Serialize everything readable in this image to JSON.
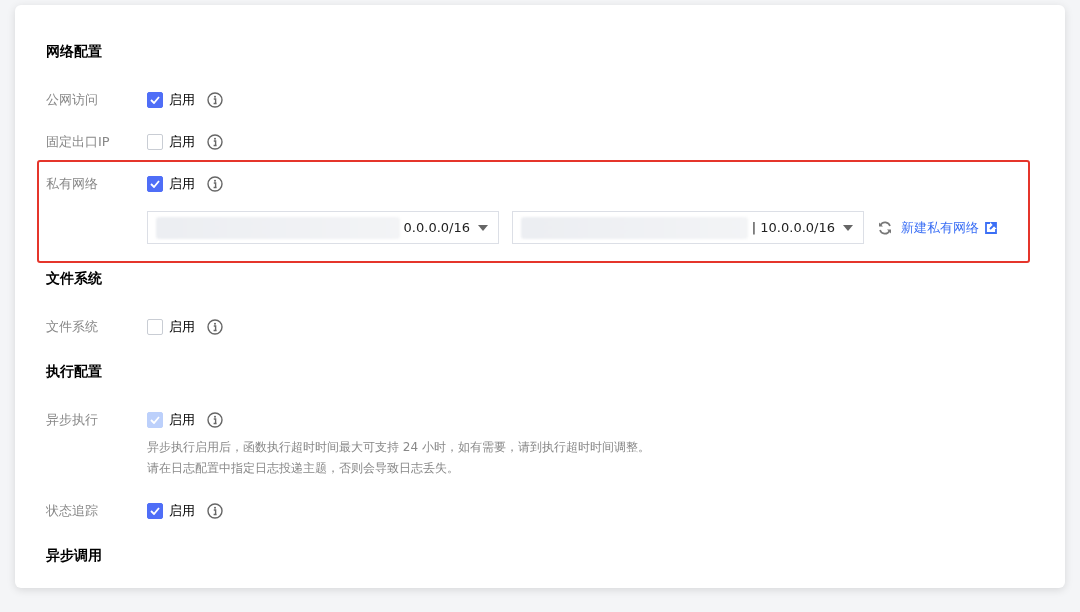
{
  "sections": [
    {
      "title": "网络配置",
      "rows": [
        {
          "label": "公网访问",
          "checkbox": {
            "label": "启用",
            "checked": true,
            "disabled": false
          }
        },
        {
          "label": "固定出口IP",
          "checkbox": {
            "label": "启用",
            "checked": false,
            "disabled": false
          }
        },
        {
          "label": "私有网络",
          "checkbox": {
            "label": "启用",
            "checked": true,
            "disabled": false
          },
          "highlighted": true,
          "selects": [
            {
              "value": "0.0.0.0/16"
            },
            {
              "value": "| 10.0.0.0/16"
            }
          ],
          "link": "新建私有网络"
        }
      ]
    },
    {
      "title": "文件系统",
      "rows": [
        {
          "label": "文件系统",
          "checkbox": {
            "label": "启用",
            "checked": false,
            "disabled": false
          }
        }
      ]
    },
    {
      "title": "执行配置",
      "rows": [
        {
          "label": "异步执行",
          "checkbox": {
            "label": "启用",
            "checked": true,
            "disabled": true
          },
          "hint": [
            "异步执行启用后，函数执行超时时间最大可支持 24 小时，如有需要，请到执行超时时间调整。",
            "请在日志配置中指定日志投递主题，否则会导致日志丢失。"
          ]
        },
        {
          "label": "状态追踪",
          "checkbox": {
            "label": "启用",
            "checked": true,
            "disabled": false
          }
        }
      ]
    },
    {
      "title": "异步调用"
    }
  ]
}
